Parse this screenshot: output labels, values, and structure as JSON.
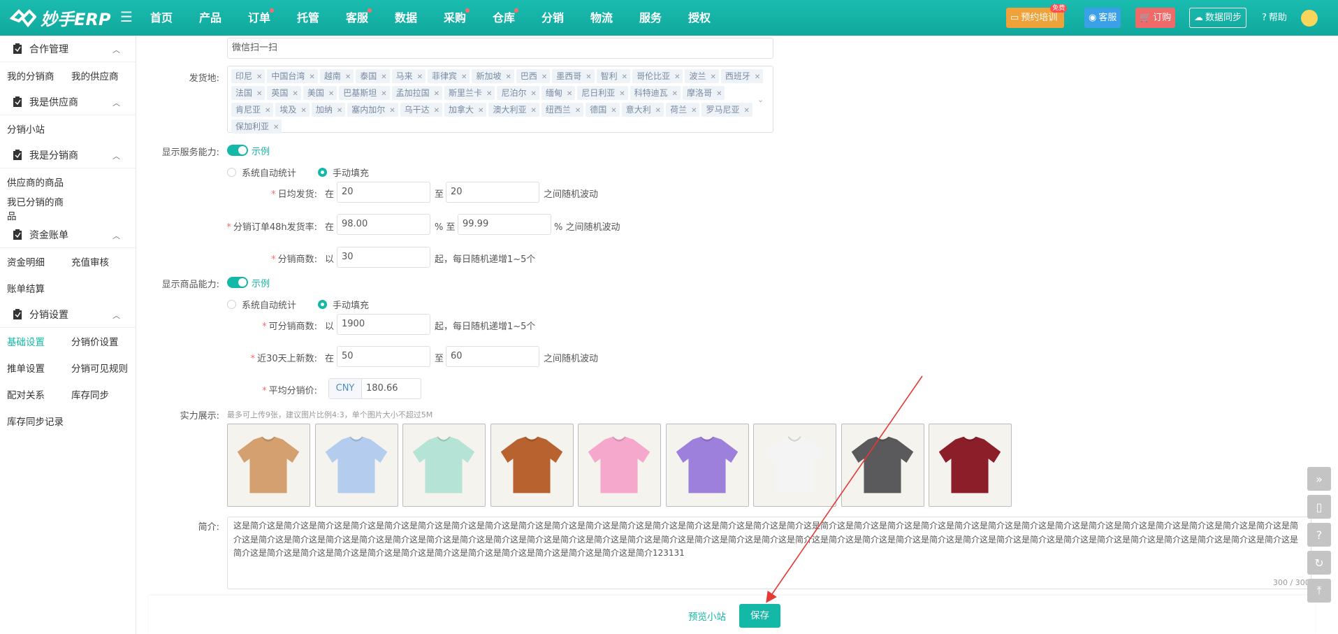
{
  "app": {
    "logo_text": "妙手ERP"
  },
  "nav": [
    {
      "label": "首页",
      "dot": false
    },
    {
      "label": "产品",
      "dot": false
    },
    {
      "label": "订单",
      "dot": true
    },
    {
      "label": "托管",
      "dot": false
    },
    {
      "label": "客服",
      "dot": true
    },
    {
      "label": "数据",
      "dot": false
    },
    {
      "label": "采购",
      "dot": true
    },
    {
      "label": "仓库",
      "dot": true
    },
    {
      "label": "分销",
      "dot": false
    },
    {
      "label": "物流",
      "dot": false
    },
    {
      "label": "服务",
      "dot": false
    },
    {
      "label": "授权",
      "dot": false
    }
  ],
  "topbar": {
    "training": "预约培训",
    "free_badge": "免费",
    "service": "客服",
    "order": "订购",
    "sync": "数据同步",
    "help": "帮助"
  },
  "sidebar": {
    "groups": [
      {
        "title": "合作管理",
        "items": [
          [
            "我的分销商",
            "我的供应商"
          ]
        ]
      },
      {
        "title": "我是供应商",
        "items": [
          [
            "分销小站"
          ]
        ]
      },
      {
        "title": "我是分销商",
        "items": [
          [
            "供应商的商品"
          ],
          [
            "我已分销的商品"
          ]
        ]
      },
      {
        "title": "资金账单",
        "items": [
          [
            "资金明细",
            "充值审核"
          ],
          [
            "账单结算"
          ]
        ]
      },
      {
        "title": "分销设置",
        "items": [
          [
            "基础设置",
            "分销价设置"
          ],
          [
            "推单设置",
            "分销可见规则"
          ],
          [
            "配对关系",
            "库存同步"
          ],
          [
            "库存同步记录"
          ]
        ]
      }
    ],
    "active": "基础设置"
  },
  "form": {
    "wechat_value": "微信扫一扫",
    "ship_from_label": "发货地:",
    "ship_from_tags": [
      "印尼",
      "中国台湾",
      "越南",
      "泰国",
      "马来",
      "菲律宾",
      "新加坡",
      "巴西",
      "墨西哥",
      "智利",
      "哥伦比亚",
      "波兰",
      "西班牙",
      "法国",
      "英国",
      "美国",
      "巴基斯坦",
      "孟加拉国",
      "斯里兰卡",
      "尼泊尔",
      "缅甸",
      "尼日利亚",
      "科特迪瓦",
      "摩洛哥",
      "肯尼亚",
      "埃及",
      "加纳",
      "塞内加尔",
      "乌干达",
      "加拿大",
      "澳大利亚",
      "纽西兰",
      "德国",
      "意大利",
      "荷兰",
      "罗马尼亚",
      "保加利亚"
    ],
    "service_label": "显示服务能力:",
    "example": "示例",
    "auto_stat": "系统自动统计",
    "manual": "手动填充",
    "daily_ship_label": "日均发货:",
    "at": "在",
    "to": "至",
    "random_between": "之间随机波动",
    "daily_min": "20",
    "daily_max": "20",
    "rate_label": "分销订单48h发货率:",
    "rate_min": "98.00",
    "rate_max": "99.99",
    "pct_to": "% 至",
    "pct_random": "% 之间随机波动",
    "dist_count_label": "分销商数:",
    "by": "以",
    "dist_count": "30",
    "daily_increase": "起，每日随机递增1~5个",
    "product_label": "显示商品能力:",
    "dist_products_label": "可分销商数:",
    "dist_products": "1900",
    "new_label": "近30天上新数:",
    "new_min": "50",
    "new_max": "60",
    "avg_price_label": "平均分销价:",
    "currency": "CNY",
    "avg_price": "180.66",
    "showcase_label": "实力展示:",
    "showcase_hint": "最多可上传9张，建议图片比例4:3，单个图片大小不超过5M",
    "intro_label": "简介:",
    "intro_text": "这是简介这是简介这是简介这是简介这是简介这是简介这是简介这是简介这是简介这是简介这是简介这是简介这是简介这是简介这是简介这是简介这是简介这是简介这是简介这是简介这是简介这是简介这是简介这是简介这是简介这是简介这是简介这是简介这是简介这是简介这是简介这是简介这是简介这是简介这是简介这是简介这是简介这是简介这是简介这是简介这是简介这是简介这是简介这是简介这是简介这是简介这是简介这是简介这是简介这是简介这是简介这是简介这是简介这是简介这是简介这是简介这是简介这是简介这是简介这是简介这是简介这是简介这是简介这是简介这是简介这是简介这是简介这是简介这是简介这是简介这是简介这是简介这是简介这是简介这是简介这是简介123131",
    "intro_counter": "300 / 300"
  },
  "tshirt_colors": [
    "#d4a070",
    "#b4cdee",
    "#b5e3d6",
    "#b8622f",
    "#f5a8cc",
    "#9c80dc",
    "#f4f4f4",
    "#5a5a5c",
    "#8c1e2a"
  ],
  "footer": {
    "preview": "预览小站",
    "save": "保存"
  },
  "colors": {
    "primary": "#14b8a6",
    "annotation_arrow": "#e53935"
  }
}
